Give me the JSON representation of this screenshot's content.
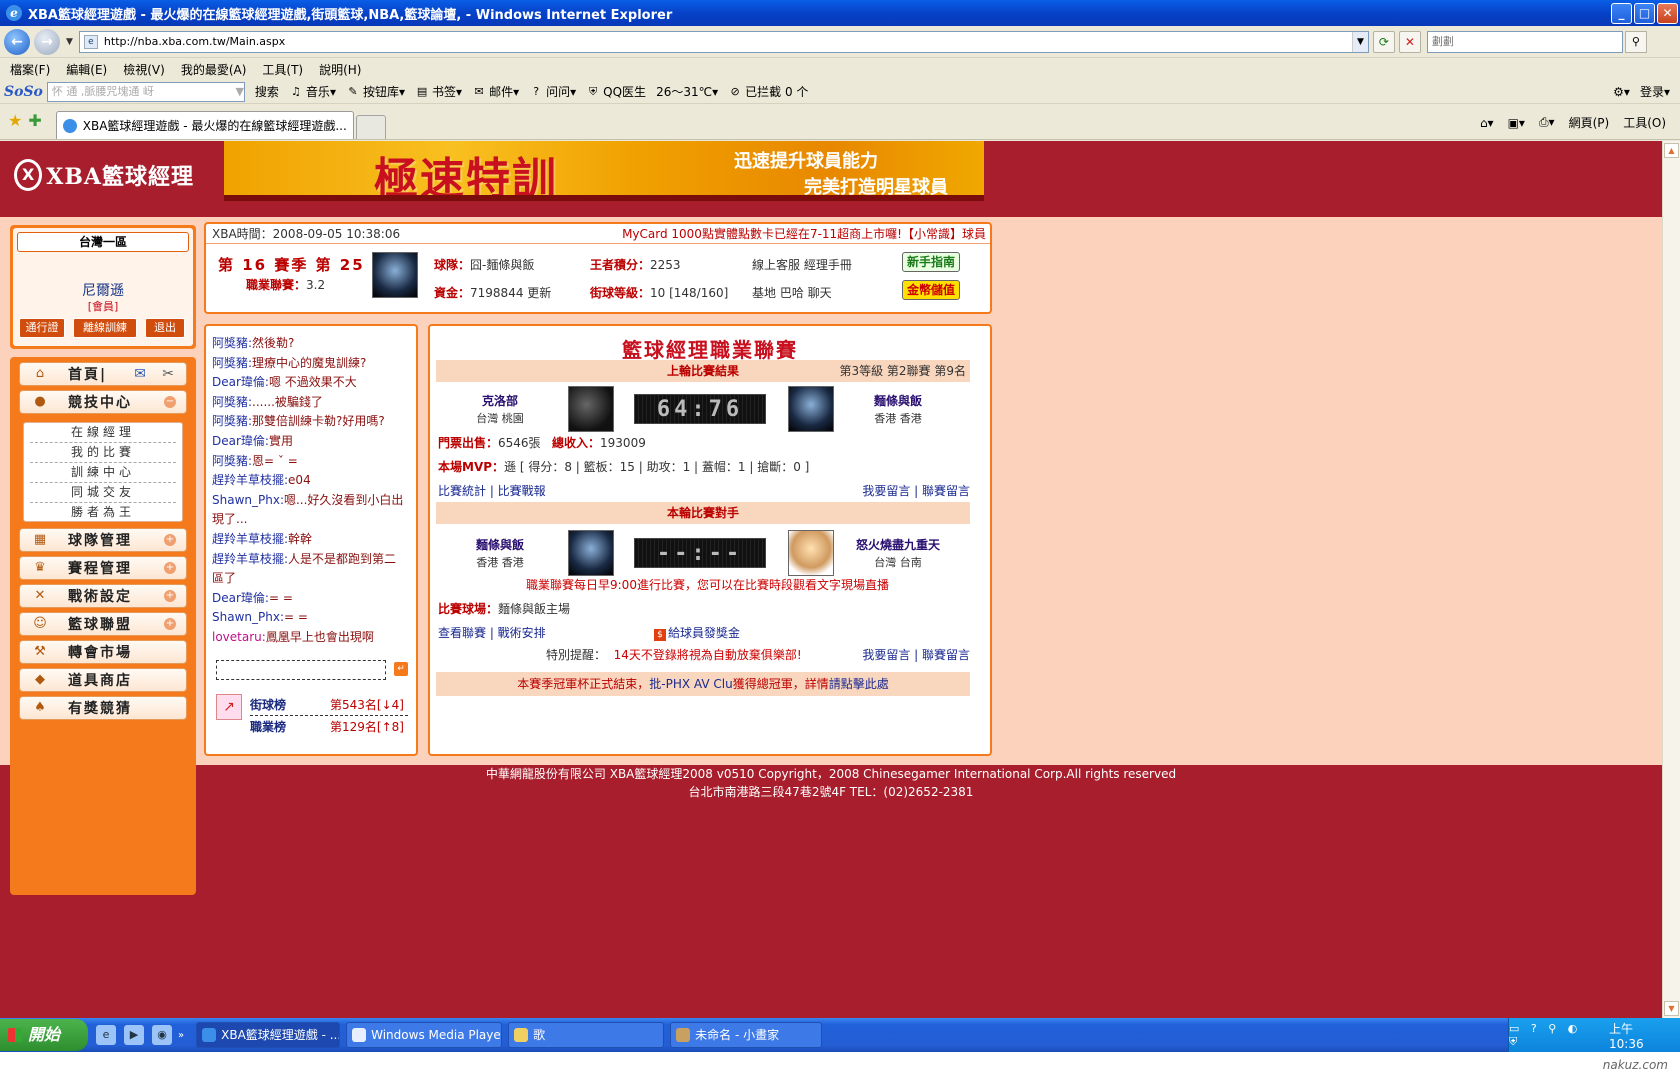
{
  "window": {
    "title": "XBA籃球經理遊戲 - 最火爆的在線籃球經理遊戲,街頭籃球,NBA,籃球論壇, - Windows Internet Explorer",
    "address": "http://nba.xba.com.tw/Main.aspx",
    "search_placeholder": "劃劃"
  },
  "menu": [
    "檔案(F)",
    "編輯(E)",
    "檢視(V)",
    "我的最愛(A)",
    "工具(T)",
    "說明(H)"
  ],
  "toolbar2": {
    "soso": "SoSo",
    "soso_placeholder": "怀 通 ,脈腰咒塊通 岈",
    "items": [
      "搜索",
      "音乐",
      "按钮库",
      "书签",
      "邮件",
      "问问",
      "QQ医生",
      "26～31℃",
      "已拦截 0 个"
    ],
    "login": "登录"
  },
  "tabbar": {
    "tab_title": "XBA籃球經理遊戲 - 最火爆的在線籃球經理遊戲...",
    "tools": [
      "網頁(P)",
      "工具(O)"
    ]
  },
  "header": {
    "logo_text": "XBA籃球經理",
    "banner_title": "極速特訓",
    "banner_line1": "迅速提升球員能力",
    "banner_line2": "完美打造明星球員"
  },
  "user": {
    "region": "台灣一區",
    "name": "尼爾遜",
    "role": "[會員]",
    "buttons": [
      "通行證",
      "離線訓練",
      "退出"
    ]
  },
  "nav": {
    "home": "首頁|",
    "arena": "競技中心",
    "sub": [
      "在線經理",
      "我的比賽",
      "訓練中心",
      "同城交友",
      "勝者為王"
    ],
    "items": [
      "球隊管理",
      "賽程管理",
      "戰術設定",
      "籃球聯盟",
      "轉會市場",
      "道具商店",
      "有獎競猜"
    ]
  },
  "info": {
    "time": "XBA時間：2008-09-05 10:38:06",
    "notice": "MyCard 1000點實體點數卡已經在7-11超商上市囉!【小常識】球員",
    "season": "第 16 賽季  第 25 輪",
    "rating_label": "職業聯賽：",
    "rating_value": "3.2",
    "team_label": "球隊：",
    "team_value": "囧-麵條與飯",
    "score_label": "王者積分：",
    "score_value": "2253",
    "cs": "線上客服  經理手冊",
    "funds_label": "資金：",
    "funds_value": "7198844  更新",
    "level_label": "街球等級：",
    "level_value": "10 [148/160]",
    "base": "基地  巴哈  聊天",
    "btn_guide": "新手指南",
    "btn_pay": "金幣儲值"
  },
  "chat": [
    {
      "u": "阿獎豬:",
      "t": "然後勒?"
    },
    {
      "u": "阿獎豬:",
      "t": "理療中心的魔鬼訓練?"
    },
    {
      "u": "Dear瑋倫:",
      "t": "嗯  不過效果不大"
    },
    {
      "u": "阿獎豬:",
      "t": "......被騙錢了"
    },
    {
      "u": "阿獎豬:",
      "t": "那雙倍訓練卡勒?好用嗎?"
    },
    {
      "u": "Dear瑋倫:",
      "t": "實用"
    },
    {
      "u": "阿獎豬:",
      "t": "恩= ˇ ="
    },
    {
      "u": "趕羚羊草枝擺:",
      "t": "e04"
    },
    {
      "u": "Shawn_Phx:",
      "t": "嗯...好久沒看到小白出現了..."
    },
    {
      "u": "趕羚羊草枝擺:",
      "t": "幹幹"
    },
    {
      "u": "趕羚羊草枝擺:",
      "t": "人是不是都跑到第二區了"
    },
    {
      "u": "Dear瑋倫:",
      "t": "= ="
    },
    {
      "u": "Shawn_Phx:",
      "t": "= ="
    },
    {
      "u": "lovetaru:",
      "t": "鳳凰早上也會出現啊"
    }
  ],
  "ranks": [
    {
      "name": "街球榜",
      "value": "第543名[↓4]"
    },
    {
      "name": "職業榜",
      "value": "第129名[↑8]"
    }
  ],
  "league": {
    "title": "籃球經理職業聯賽",
    "last_header": "上輪比賽結果",
    "last_info": "第3等級  第2聯賽  第9名",
    "home_name": "克洛部",
    "home_loc": "台灣  桃園",
    "score": "64:76",
    "away_name": "麵條與飯",
    "away_loc": "香港  香港",
    "tickets_label": "門票出售：",
    "tickets_value": "6546張",
    "income_label": "總收入：",
    "income_value": "193009",
    "mvp_label": "本場MVP：",
    "mvp_value": "遜  [ 得分：8 | 籃板：15 | 助攻：1 | 蓋帽：1 | 搶斷：0 ]",
    "links1": "比賽統計 | 比賽戰報",
    "links_msg": "我要留言 | 聯賽留言",
    "next_header": "本輪比賽對手",
    "next_home_name": "麵條與飯",
    "next_home_loc": "香港  香港",
    "next_score": "--:--",
    "next_away_name": "怒火燒盡九重天",
    "next_away_loc": "台灣  台南",
    "schedule_note": "職業聯賽每日早9:00進行比賽，您可以在比賽時段觀看文字現場直播",
    "venue_label": "比賽球場：",
    "venue_value": "麵條與飯主場",
    "links2": "查看聯賽 | 戰術安排",
    "bonus": "給球員發獎金",
    "remind_label": "特別提醒：",
    "remind_value": "14天不登錄將視為自動放棄俱樂部!",
    "champ_pre": "本賽季冠軍杯正式結束，",
    "champ_link": "批-PHX AV Clu",
    "champ_mid": "獲得總冠軍，詳情",
    "champ_link2": "請點擊此處"
  },
  "footer": {
    "line1": "中華網龍股份有限公司  XBA籃球經理2008 v0510     Copyright，2008 Chinesegamer International Corp.All rights reserved",
    "line2": "台北市南港路三段47巷2號4F TEL：(02)2652-2381"
  },
  "taskbar": {
    "start": "開始",
    "tasks": [
      "XBA籃球經理遊戲 - ...",
      "Windows Media Player",
      "歌",
      "未命名 - 小畫家"
    ],
    "clock": "上午 10:36"
  },
  "watermark": "nakuz.com"
}
